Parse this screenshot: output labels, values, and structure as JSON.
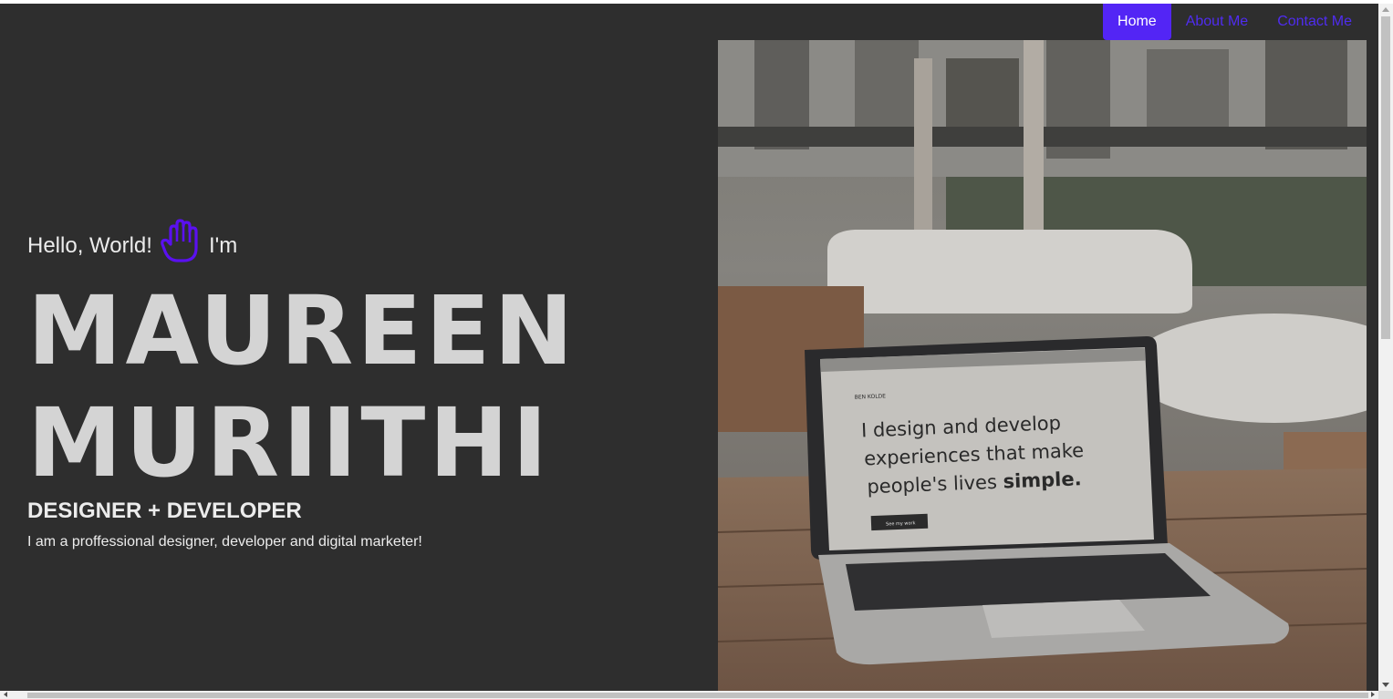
{
  "nav": {
    "items": [
      {
        "label": "Home",
        "active": true
      },
      {
        "label": "About Me",
        "active": false
      },
      {
        "label": "Contact Me",
        "active": false
      }
    ],
    "accent": "#5325f5"
  },
  "hero": {
    "greeting_before": "Hello, World!",
    "greeting_icon": "waving-hand-icon",
    "greeting_after": "I'm",
    "name_line1": "MAUREEN",
    "name_line2": "MURIITHI",
    "role": "DESIGNER + DEVELOPER",
    "bio": "I am a proffessional designer, developer and digital marketer!"
  },
  "photo": {
    "laptop_screen_brand": "BEN KOLDE",
    "laptop_screen_line1": "I design and develop",
    "laptop_screen_line2": "experiences that make",
    "laptop_screen_line3_pre": "people's lives ",
    "laptop_screen_line3_bold": "simple.",
    "laptop_screen_button": "See my work"
  },
  "colors": {
    "background": "#2e2e2e",
    "name_text": "#d4d4d4",
    "body_text": "#ececec",
    "link": "#4f2cf0"
  }
}
